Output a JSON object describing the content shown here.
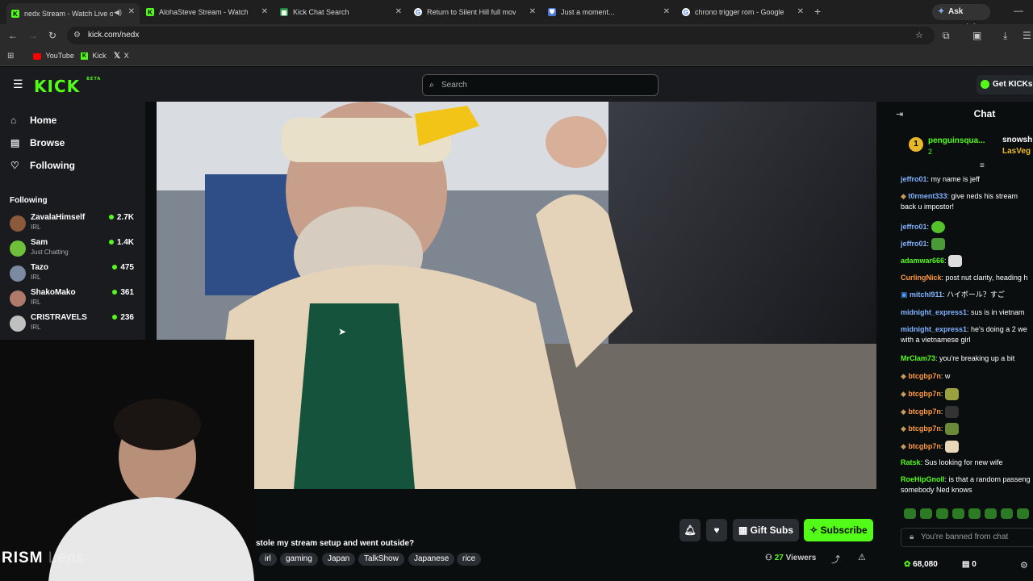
{
  "browser": {
    "tabs": [
      {
        "title": "nedx Stream - Watch Live o",
        "favicon": "kick-icon",
        "color": "#53fc18",
        "active": true
      },
      {
        "title": "AlohaSteve Stream - Watch Live",
        "favicon": "kick-icon",
        "color": "#53fc18",
        "active": false
      },
      {
        "title": "Kick Chat Search",
        "favicon": "sheet-icon",
        "color": "#1e8e3e",
        "active": false
      },
      {
        "title": "Return to Silent Hill full movie",
        "favicon": "google-icon",
        "color": "#ffffff",
        "active": false
      },
      {
        "title": "Just a moment...",
        "favicon": "shield-icon",
        "color": "#4a7bd4",
        "active": false
      },
      {
        "title": "chrono trigger rom - Google Se",
        "favicon": "google-icon",
        "color": "#ffffff",
        "active": false
      }
    ],
    "ask_gemini": "Ask Gemini",
    "url": "kick.com/nedx",
    "bookmarks": [
      "YouTube",
      "Kick",
      "X"
    ]
  },
  "kick": {
    "logo": "KICK",
    "logo_badge": "BETA",
    "search_placeholder": "Search",
    "get_kicks": "Get KICKs",
    "nav": [
      {
        "label": "Home",
        "icon": "home-icon"
      },
      {
        "label": "Browse",
        "icon": "browse-icon"
      },
      {
        "label": "Following",
        "icon": "heart-icon"
      }
    ],
    "following_header": "Following",
    "following": [
      {
        "name": "ZavalaHimself",
        "category": "IRL",
        "viewers": "2.7K",
        "color": "#8a5a3a"
      },
      {
        "name": "Sam",
        "category": "Just Chatting",
        "viewers": "1.4K",
        "color": "#6fbf3a"
      },
      {
        "name": "Tazo",
        "category": "IRL",
        "viewers": "475",
        "color": "#7a8aa0"
      },
      {
        "name": "ShakoMako",
        "category": "IRL",
        "viewers": "361",
        "color": "#b07a6a"
      },
      {
        "name": "CRISTRAVELS",
        "category": "IRL",
        "viewers": "236",
        "color": "#c0c0c0"
      }
    ],
    "stream": {
      "title": "stole my stream setup and went outside?",
      "tags": [
        "irl",
        "gaming",
        "Japan",
        "TalkShow",
        "Japanese",
        "rice"
      ],
      "viewers": "27",
      "viewers_label": "Viewers",
      "gift_subs": "Gift Subs",
      "subscribe": "Subscribe",
      "webcam_overlay_text": "RISM",
      "webcam_overlay_faded": "Lens"
    },
    "chat": {
      "title": "Chat",
      "pinned": {
        "rank": "1",
        "user": "penguinsqua...",
        "count": "2",
        "user2": "snowsh",
        "user3": "LasVeg"
      },
      "messages": [
        {
          "user": "jeffro01",
          "text": ": my name is jeff",
          "color": "#7fb2ff"
        },
        {
          "user": "t0rment333",
          "text": ": give neds his stream back u impostor!",
          "color": "#7fb2ff"
        },
        {
          "user": "jeffro01",
          "text": ":",
          "color": "#7fb2ff"
        },
        {
          "user": "jeffro01",
          "text": ":",
          "color": "#7fb2ff"
        },
        {
          "user": "adamwar666",
          "text": ":",
          "color": "#53fc18"
        },
        {
          "user": "CurlingNick",
          "text": ": post nut clarity, heading h",
          "color": "#ff9a3c"
        },
        {
          "user": "mitchl911",
          "text": ": ハイボール？すご",
          "color": "#7fb2ff"
        },
        {
          "user": "midnight_express1",
          "text": ": sus is in vietnam",
          "color": "#7fb2ff"
        },
        {
          "user": "midnight_express1",
          "text": ": he's doing a 2 we with a vietnamese girl",
          "color": "#7fb2ff"
        },
        {
          "user": "MrClam73",
          "text": ": you're breaking up a bit",
          "color": "#53fc18"
        },
        {
          "user": "btcgbp7n",
          "text": ": w",
          "color": "#ff9a3c"
        },
        {
          "user": "btcgbp7n",
          "text": ":",
          "color": "#ff9a3c"
        },
        {
          "user": "btcgbp7n",
          "text": ":",
          "color": "#ff9a3c"
        },
        {
          "user": "btcgbp7n",
          "text": ":",
          "color": "#ff9a3c"
        },
        {
          "user": "btcgbp7n",
          "text": ":",
          "color": "#ff9a3c"
        },
        {
          "user": "Ratsk",
          "text": ": Sus looking for new wife",
          "color": "#53fc18"
        },
        {
          "user": "RoeHipGnoll",
          "text": ": is that a random passeng somebody Ned knows",
          "color": "#53fc18"
        }
      ],
      "banned": "You're banned from chat",
      "points": "68,080",
      "chest": "0"
    },
    "colors": {
      "accent": "#53fc18",
      "bg": "#0b0e0f",
      "panel": "#191b1f"
    }
  }
}
